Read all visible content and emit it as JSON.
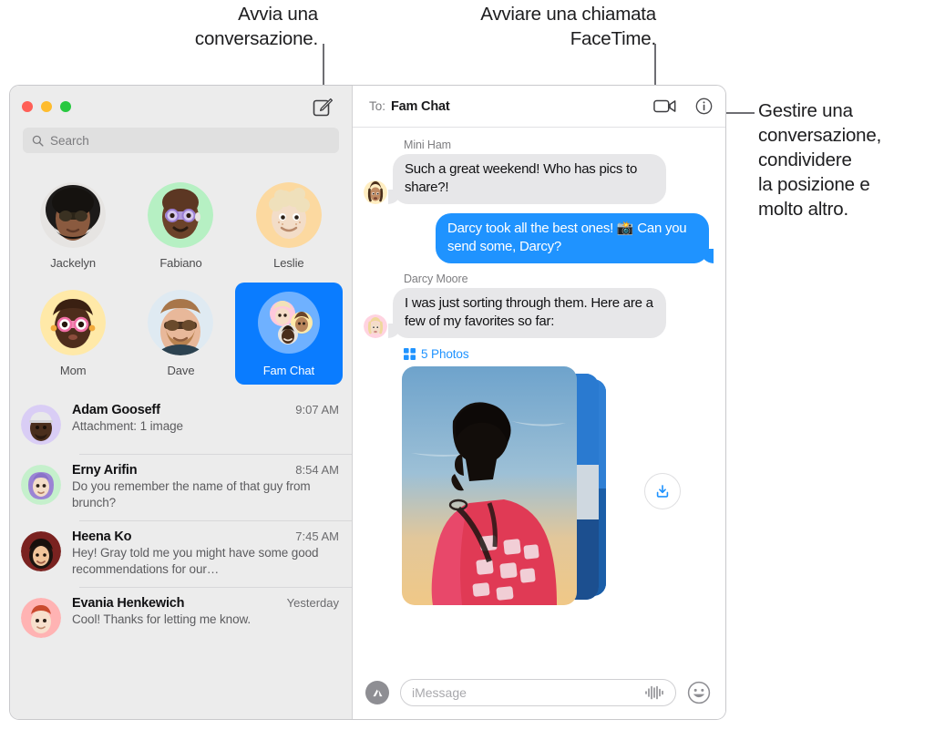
{
  "callouts": {
    "compose": "Avvia una\nconversazione.",
    "facetime": "Avviare una chiamata\nFaceTime.",
    "info": "Gestire una\nconversazione,\ncondividere\nla posizione e\nmolto altro."
  },
  "window": {
    "traffic": {
      "close": "close-button",
      "minimize": "minimize-button",
      "maximize": "maximize-button"
    },
    "compose_icon": "compose-icon"
  },
  "sidebar": {
    "search": {
      "placeholder": "Search",
      "value": "",
      "icon": "search-icon"
    },
    "pinned": [
      {
        "label": "Jackelyn",
        "selected": false,
        "avatar": "photo-woman-sunglasses"
      },
      {
        "label": "Fabiano",
        "selected": false,
        "avatar": "memoji-bald-purple-glasses"
      },
      {
        "label": "Leslie",
        "selected": false,
        "avatar": "memoji-blond-curly"
      },
      {
        "label": "Mom",
        "selected": false,
        "avatar": "memoji-pink-glasses"
      },
      {
        "label": "Dave",
        "selected": false,
        "avatar": "photo-man-sunglasses"
      },
      {
        "label": "Fam Chat",
        "selected": true,
        "avatar": "group-avatar-three"
      }
    ],
    "conversations": [
      {
        "name": "Adam Gooseff",
        "time": "9:07 AM",
        "preview": "Attachment: 1 image",
        "avatar": "memoji-cap-purple"
      },
      {
        "name": "Erny Arifin",
        "time": "8:54 AM",
        "preview": "Do you remember the name of that guy from brunch?",
        "avatar": "memoji-hijab-green"
      },
      {
        "name": "Heena Ko",
        "time": "7:45 AM",
        "preview": "Hey! Gray told me you might have some good recommendations for our…",
        "avatar": "photo-woman-smiling"
      },
      {
        "name": "Evania Henkewich",
        "time": "Yesterday",
        "preview": "Cool! Thanks for letting me know.",
        "avatar": "memoji-red-hair-pink"
      }
    ]
  },
  "chat": {
    "to_label": "To:",
    "to_value": "Fam Chat",
    "facetime_icon": "video-camera-icon",
    "info_icon": "info-circle-icon",
    "messages": [
      {
        "sender": "Mini Ham",
        "text": "Such a great weekend! Who has pics to share?!",
        "direction": "in",
        "avatar": "memoji-mini-ham"
      },
      {
        "sender": "",
        "text": "Darcy took all the best ones! 📸 Can you send some, Darcy?",
        "direction": "out",
        "avatar": ""
      },
      {
        "sender": "Darcy Moore",
        "text": "I was just sorting through them. Here are a few of my favorites so far:",
        "direction": "in",
        "avatar": "memoji-darcy"
      }
    ],
    "attachment": {
      "count_label": "5 Photos",
      "grid_icon": "grid-icon",
      "download_icon": "download-icon"
    }
  },
  "composer": {
    "apps_icon": "app-store-icon",
    "placeholder": "iMessage",
    "value": "",
    "audio_icon": "audio-waveform-icon",
    "emoji_icon": "smiley-icon"
  },
  "colors": {
    "accent_blue": "#0a7cff",
    "bubble_out": "#1f93ff",
    "bubble_in": "#e7e7e9",
    "sidebar_bg": "#ececec",
    "close": "#ff5f57",
    "minimize": "#febc2e",
    "maximize": "#28c840"
  }
}
